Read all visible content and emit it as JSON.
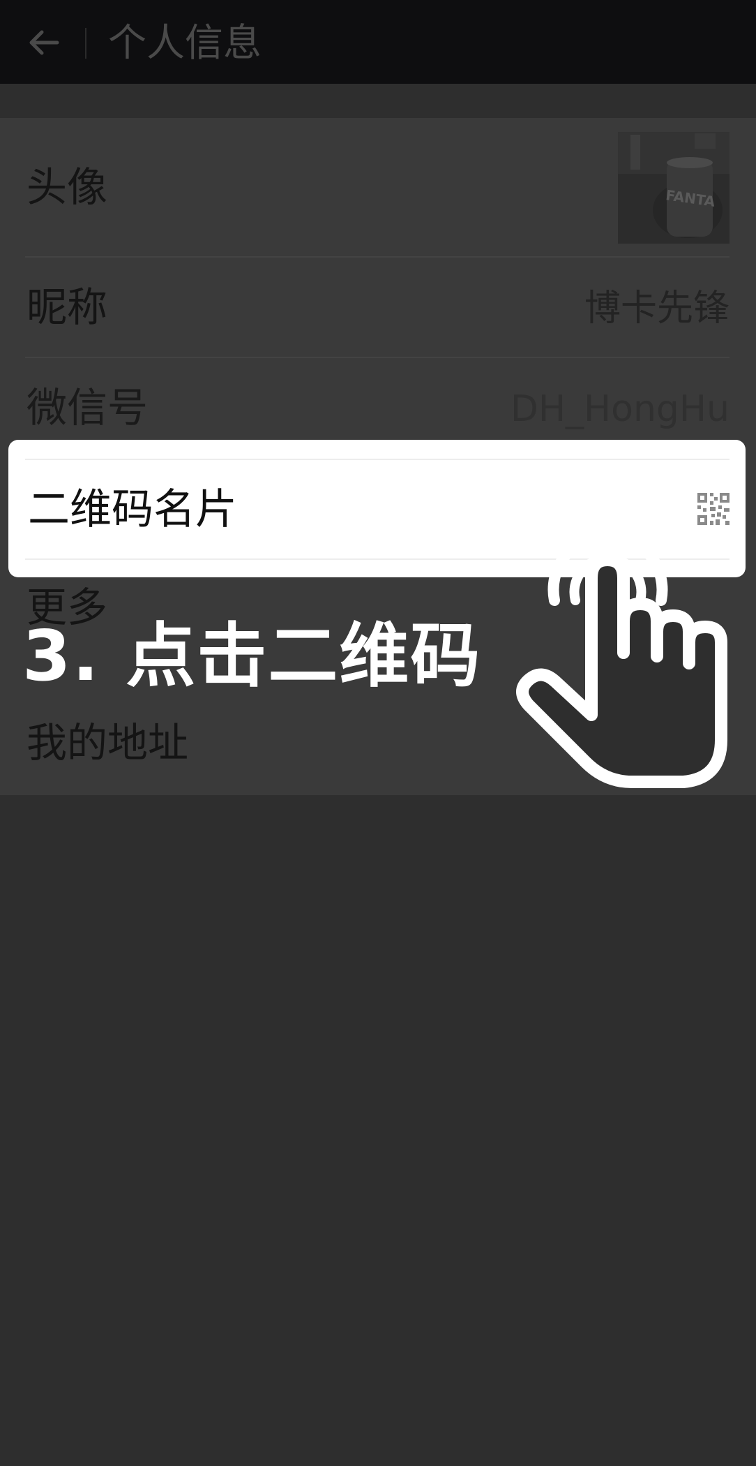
{
  "header": {
    "title": "个人信息"
  },
  "rows": [
    {
      "label": "头像",
      "value": ""
    },
    {
      "label": "昵称",
      "value": "博卡先锋"
    },
    {
      "label": "微信号",
      "value": "DH_HongHu"
    },
    {
      "label": "二维码名片",
      "value": ""
    },
    {
      "label": "更多",
      "value": ""
    },
    {
      "label": "我的地址",
      "value": ""
    }
  ],
  "avatar": {
    "brand_text": "FANTA"
  },
  "tutorial": {
    "step_caption": "3. 点击二维码"
  },
  "colors": {
    "overlay_background": "#2e2e2e",
    "highlight": "#ffffff",
    "caption_text": "#ffffff"
  }
}
